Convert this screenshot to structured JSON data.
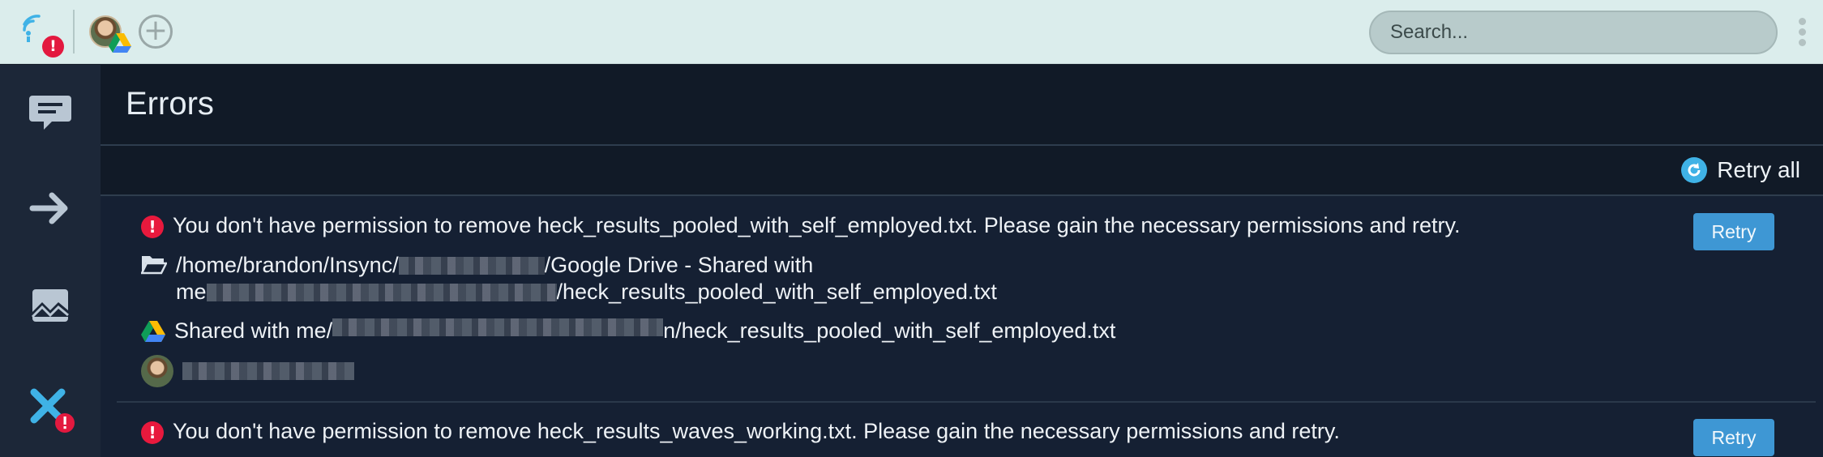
{
  "topbar": {
    "search_placeholder": "Search..."
  },
  "main": {
    "title": "Errors",
    "retry_all_label": "Retry all"
  },
  "errors": [
    {
      "message": "You don't have permission to remove heck_results_pooled_with_self_employed.txt. Please gain the necessary permissions and retry.",
      "local_path_part1": "/home/brandon/Insync/",
      "local_path_part2": "/Google Drive - Shared with",
      "local_path_part3": "me",
      "local_path_part4": "/heck_results_pooled_with_self_employed.txt",
      "cloud_path_part1": "Shared with me/",
      "cloud_path_part2": "n/heck_results_pooled_with_self_employed.txt",
      "retry_label": "Retry"
    },
    {
      "message": "You don't have permission to remove heck_results_waves_working.txt. Please gain the necessary permissions and retry.",
      "retry_label": "Retry"
    }
  ],
  "colors": {
    "topbar": "#dbedec",
    "sidebar": "#1c2738",
    "main": "#111a27",
    "accent": "#3fb2e6",
    "retry_button": "#3e97d4",
    "error": "#e8193d"
  }
}
